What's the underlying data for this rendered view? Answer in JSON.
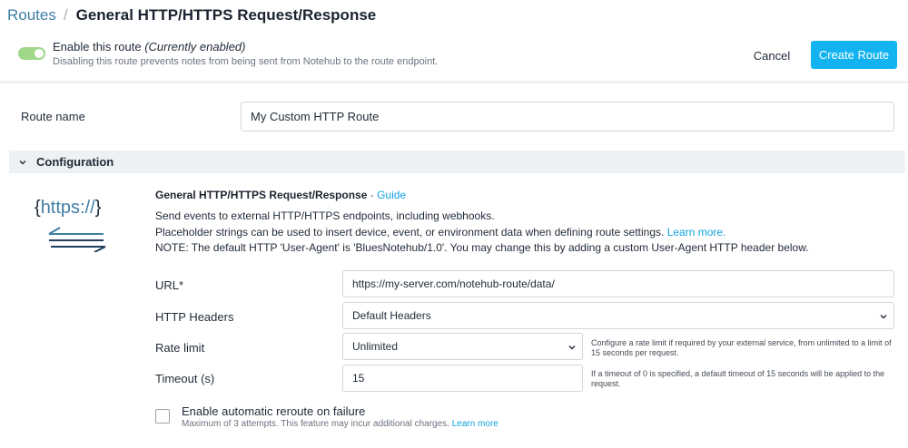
{
  "breadcrumb": {
    "root": "Routes",
    "separator": "/",
    "title": "General HTTP/HTTPS Request/Response"
  },
  "enable": {
    "label": "Enable this route",
    "status": "(Currently enabled)",
    "description": "Disabling this route prevents notes from being sent from Notehub to the route endpoint.",
    "enabled": true
  },
  "actions": {
    "cancel": "Cancel",
    "create": "Create Route"
  },
  "route_name": {
    "label": "Route name",
    "value": "My Custom HTTP Route"
  },
  "configuration": {
    "label": "Configuration",
    "logo": {
      "open_brace": "{",
      "text": "https://",
      "close_brace": "}"
    },
    "service_title": "General HTTP/HTTPS Request/Response",
    "title_separator": " - ",
    "guide_link": "Guide",
    "description_1": "Send events to external HTTP/HTTPS endpoints, including webhooks.",
    "description_2": "Placeholder strings can be used to insert device, event, or environment data when defining route settings.",
    "learn_more": "Learn more.",
    "note": "NOTE: The default HTTP 'User-Agent' is 'BluesNotehub/1.0'. You may change this by adding a custom User-Agent HTTP header below."
  },
  "fields": {
    "url": {
      "label": "URL*",
      "value": "https://my-server.com/notehub-route/data/"
    },
    "headers": {
      "label": "HTTP Headers",
      "value": "Default Headers"
    },
    "rate_limit": {
      "label": "Rate limit",
      "value": "Unlimited",
      "hint": "Configure a rate limit if required by your external service, from unlimited to a limit of 15 seconds per request."
    },
    "timeout": {
      "label": "Timeout (s)",
      "value": "15",
      "hint": "If a timeout of 0 is specified, a default timeout of 15 seconds will be applied to the request."
    }
  },
  "reroute": {
    "label": "Enable automatic reroute on failure",
    "description": "Maximum of 3 attempts. This feature may incur additional charges.",
    "link": "Learn more",
    "checked": false
  },
  "colors": {
    "accent": "#12b3f0",
    "link": "#12a4e0",
    "toggle_on": "#9fd889"
  }
}
